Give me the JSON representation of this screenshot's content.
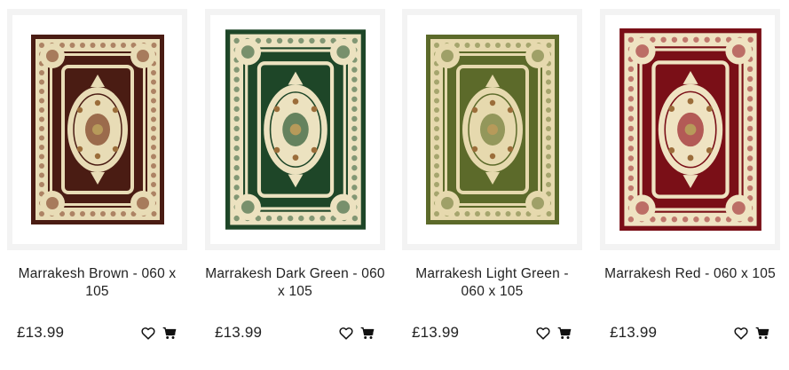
{
  "currency_prefix": "£",
  "products": [
    {
      "title": "Marrakesh Brown - 060 x 105",
      "price": "£13.99",
      "rug": {
        "field": "#4a1c13",
        "border": "#e8dcb6",
        "accent": "#7b3a20"
      }
    },
    {
      "title": "Marrakesh Dark Green - 060 x 105",
      "price": "£13.99",
      "rug": {
        "field": "#1e4628",
        "border": "#ece2c0",
        "accent": "#2c5a34"
      }
    },
    {
      "title": "Marrakesh Light Green - 060 x 105",
      "price": "£13.99",
      "rug": {
        "field": "#5c6a2a",
        "border": "#e6d9ae",
        "accent": "#6f7a38"
      }
    },
    {
      "title": "Marrakesh Red - 060 x 105",
      "price": "£13.99",
      "rug": {
        "field": "#7a0f17",
        "border": "#efe3c2",
        "accent": "#9a2028"
      }
    }
  ],
  "icons": {
    "wishlist": "heart-icon",
    "cart": "cart-icon"
  }
}
